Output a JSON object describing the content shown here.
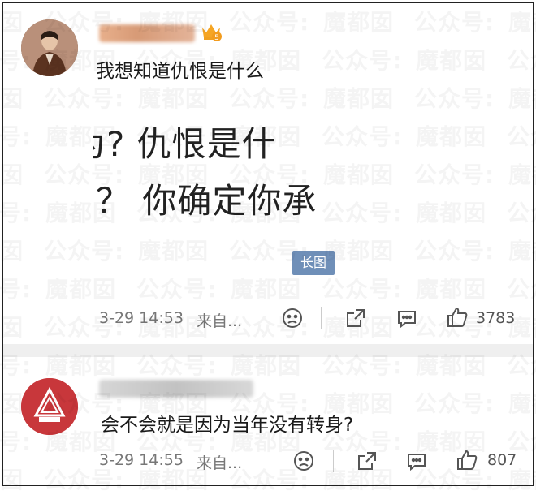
{
  "watermark": {
    "text_a": "公众号:",
    "text_b": "魔都囡"
  },
  "comments": [
    {
      "username": "",
      "text": "我想知道仇恨是什么",
      "image_lines": [
        "为?  仇恨是什",
        "？ 你确定你承"
      ],
      "long_image_label": "长图",
      "date": "3-29 14:53",
      "source": "来自...",
      "like_count": "3783",
      "icons": [
        "dislike-face-icon",
        "share-icon",
        "comment-icon",
        "like-thumb-icon"
      ]
    },
    {
      "username": "",
      "text": "会不会就是因为当年没有转身?",
      "date": "3-29 14:55",
      "source": "来自...",
      "like_count": "807",
      "icons": [
        "dislike-face-icon",
        "share-icon",
        "comment-icon",
        "like-thumb-icon"
      ]
    }
  ],
  "colors": {
    "accent_button": "#6f8fb8",
    "avatar2_bg": "#c8373b",
    "gap": "#efefef"
  }
}
